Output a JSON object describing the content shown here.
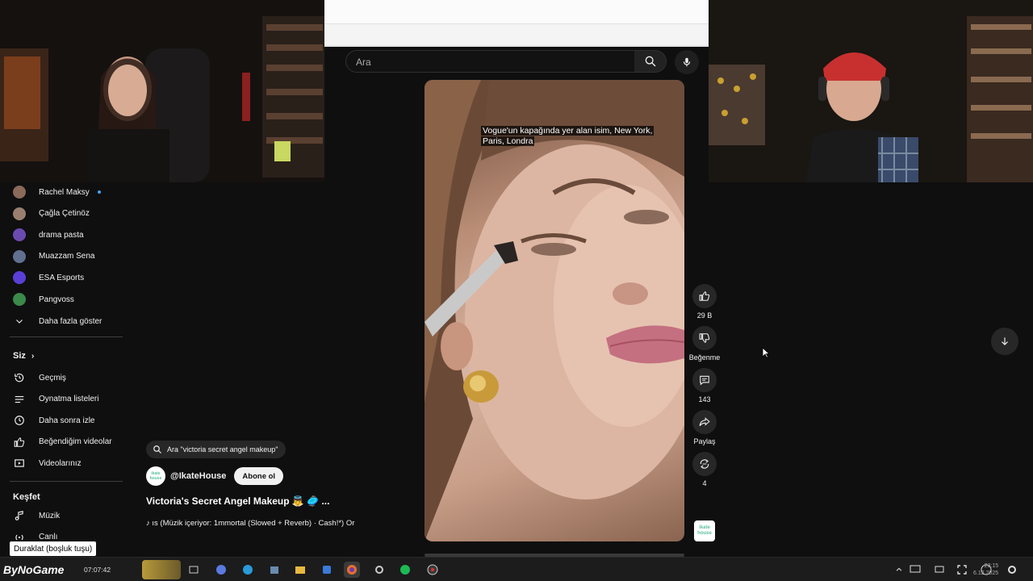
{
  "search": {
    "placeholder": "Ara"
  },
  "video": {
    "caption": "Vogue'un kapağında yer alan isim, New York, Paris, Londra",
    "progress": 0.0
  },
  "actions": {
    "like_count": "29 B",
    "dislike_label": "Beğenme",
    "comment_count": "143",
    "share_label": "Paylaş",
    "remix_count": "4",
    "channel_badge": "ikate house"
  },
  "sidebar": {
    "subscriptions": [
      {
        "label": "Rachel Maksy",
        "color": "#8a6a5a",
        "new": true
      },
      {
        "label": "Çağla Çetinöz",
        "color": "#9a7f70",
        "new": false
      },
      {
        "label": "drama pasta",
        "color": "#6c4bb0",
        "new": false
      },
      {
        "label": "Muazzam Sena",
        "color": "#607090",
        "new": false
      },
      {
        "label": "ESA Esports",
        "color": "#5a3fd6",
        "new": false
      },
      {
        "label": "Pangvoss",
        "color": "#3a8a4a",
        "new": false
      }
    ],
    "show_more": "Daha fazla göster",
    "you_heading": "Siz",
    "you_items": [
      {
        "label": "Geçmiş",
        "icon": "history-icon"
      },
      {
        "label": "Oynatma listeleri",
        "icon": "playlist-icon"
      },
      {
        "label": "Daha sonra izle",
        "icon": "clock-icon"
      },
      {
        "label": "Beğendiğim videolar",
        "icon": "thumb-up-icon"
      },
      {
        "label": "Videolarınız",
        "icon": "video-icon"
      }
    ],
    "explore_heading": "Keşfet",
    "explore_items": [
      {
        "label": "Müzik",
        "icon": "music-icon"
      },
      {
        "label": "Canlı",
        "icon": "live-icon"
      }
    ]
  },
  "info": {
    "suggest": "Ara \"victoria secret angel makeup\"",
    "channel_avatar": "ikate house",
    "channel": "@IkateHouse",
    "subscribe": "Abone ol",
    "title": "Victoria's Secret Angel Makeup 👼 🥏 ...",
    "music": "♪ ıs (Müzik içeriyor: 1mmortal (Slowed + Reverb) · Cash!*)    Or"
  },
  "tooltip": "Duraklat (boşluk tuşu)",
  "taskbar": {
    "logo": "ByNoGame",
    "time": "07:07:42",
    "clock": "23:15\n6.12.2025"
  },
  "colors": {
    "accent": "#3ea6ff",
    "background": "#0f0f0f",
    "surface": "#272727"
  }
}
